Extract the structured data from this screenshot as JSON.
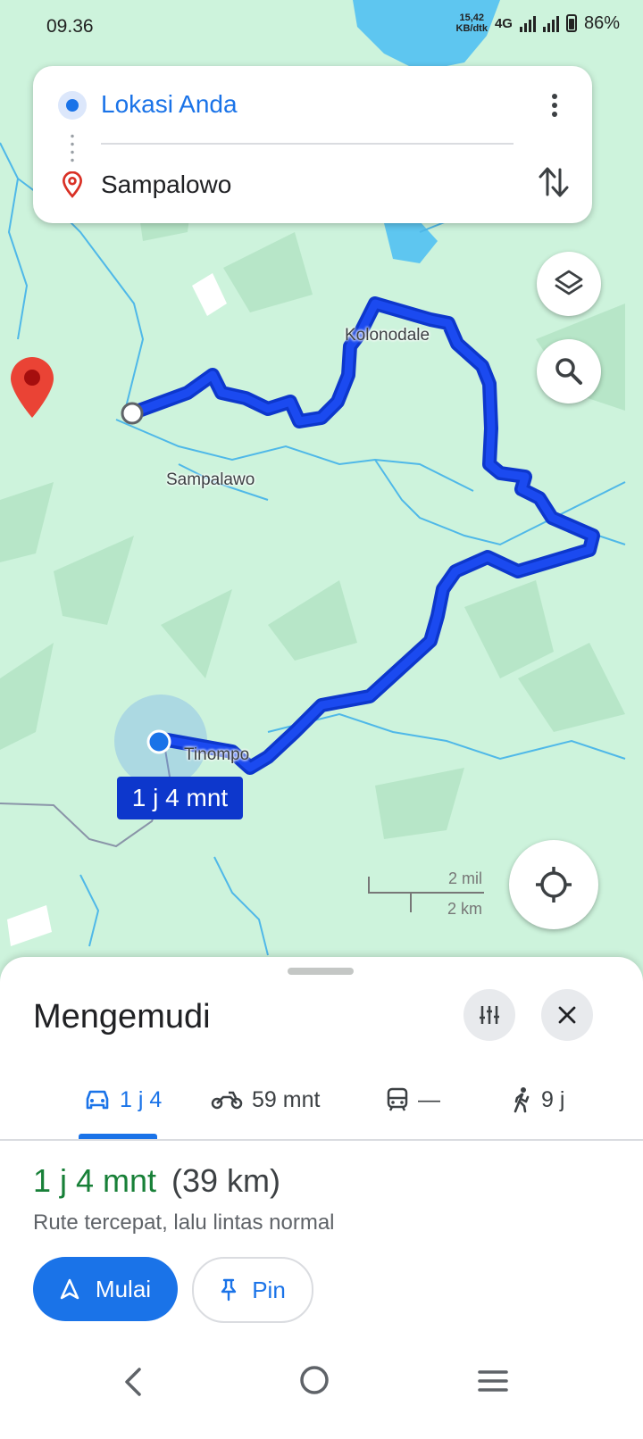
{
  "status_bar": {
    "time": "09.36",
    "speed_value": "15,42",
    "speed_unit": "KB/dtk",
    "network": "4G",
    "battery": "86%"
  },
  "directions": {
    "origin": "Lokasi Anda",
    "destination": "Sampalowo"
  },
  "map": {
    "labels": {
      "kolonodale": "Kolonodale",
      "sampalawo": "Sampalawo",
      "tinompo": "Tinompo"
    },
    "route_duration": "1 j 4 mnt",
    "scale_miles": "2 mil",
    "scale_km": "2 km",
    "colors": {
      "route": "#0d37cc",
      "land": "#cdf3dc",
      "water": "#5ec6f0",
      "marker": "#ea4335"
    }
  },
  "sheet": {
    "title": "Mengemudi",
    "modes": [
      {
        "icon": "car-icon",
        "label": "1 j 4"
      },
      {
        "icon": "motorcycle-icon",
        "label": "59 mnt"
      },
      {
        "icon": "train-icon",
        "label": "—"
      },
      {
        "icon": "walk-icon",
        "label": "9 j"
      }
    ],
    "route_time": "1 j 4 mnt",
    "route_distance": "(39 km)",
    "route_description": "Rute tercepat, lalu lintas normal",
    "start_label": "Mulai",
    "pin_label": "Pin"
  }
}
